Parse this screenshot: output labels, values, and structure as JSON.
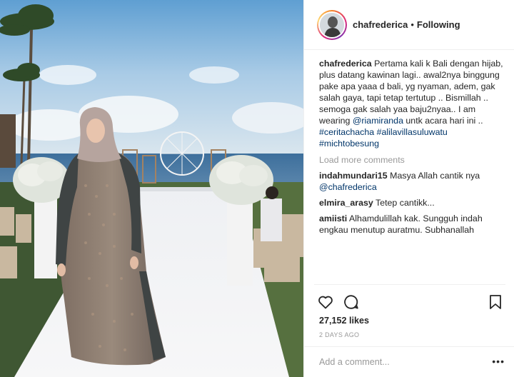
{
  "post": {
    "username": "chafrederica",
    "follow_status": "Following",
    "photo_alt": "chafrederica photo"
  },
  "caption": {
    "username": "chafrederica",
    "text_1": "Pertama kali k Bali dengan hijab, plus datang kawinan lagi.. awal2nya binggung pake apa yaaa d bali, yg nyaman, adem, gak salah gaya, tapi tetap tertutup .. Bismillah .. semoga gak salah yaa baju2nyaa.. I am wearing ",
    "mention": "@riamiranda",
    "text_2": " untk acara hari ini .. ",
    "tags": [
      "#ceritachacha",
      "#alilavillasuluwatu",
      "#michtobesung"
    ]
  },
  "load_more": "Load more comments",
  "comments": [
    {
      "user": "indahmundari15",
      "text": "Masya Allah cantik nya ",
      "mention": "@chafrederica"
    },
    {
      "user": "elmira_arasy",
      "text": "Tetep cantikk...",
      "mention": ""
    },
    {
      "user": "amiisti",
      "text": "Alhamdulillah kak. Sungguh indah engkau menutup auratmu. Subhanallah",
      "mention": ""
    }
  ],
  "actions": {
    "like_icon": "heart-icon",
    "comment_icon": "comment-bubble-icon",
    "save_icon": "bookmark-icon"
  },
  "likes": "27,152 likes",
  "date": "2 DAYS AGO",
  "add_comment_placeholder": "Add a comment...",
  "more_label": "•••"
}
